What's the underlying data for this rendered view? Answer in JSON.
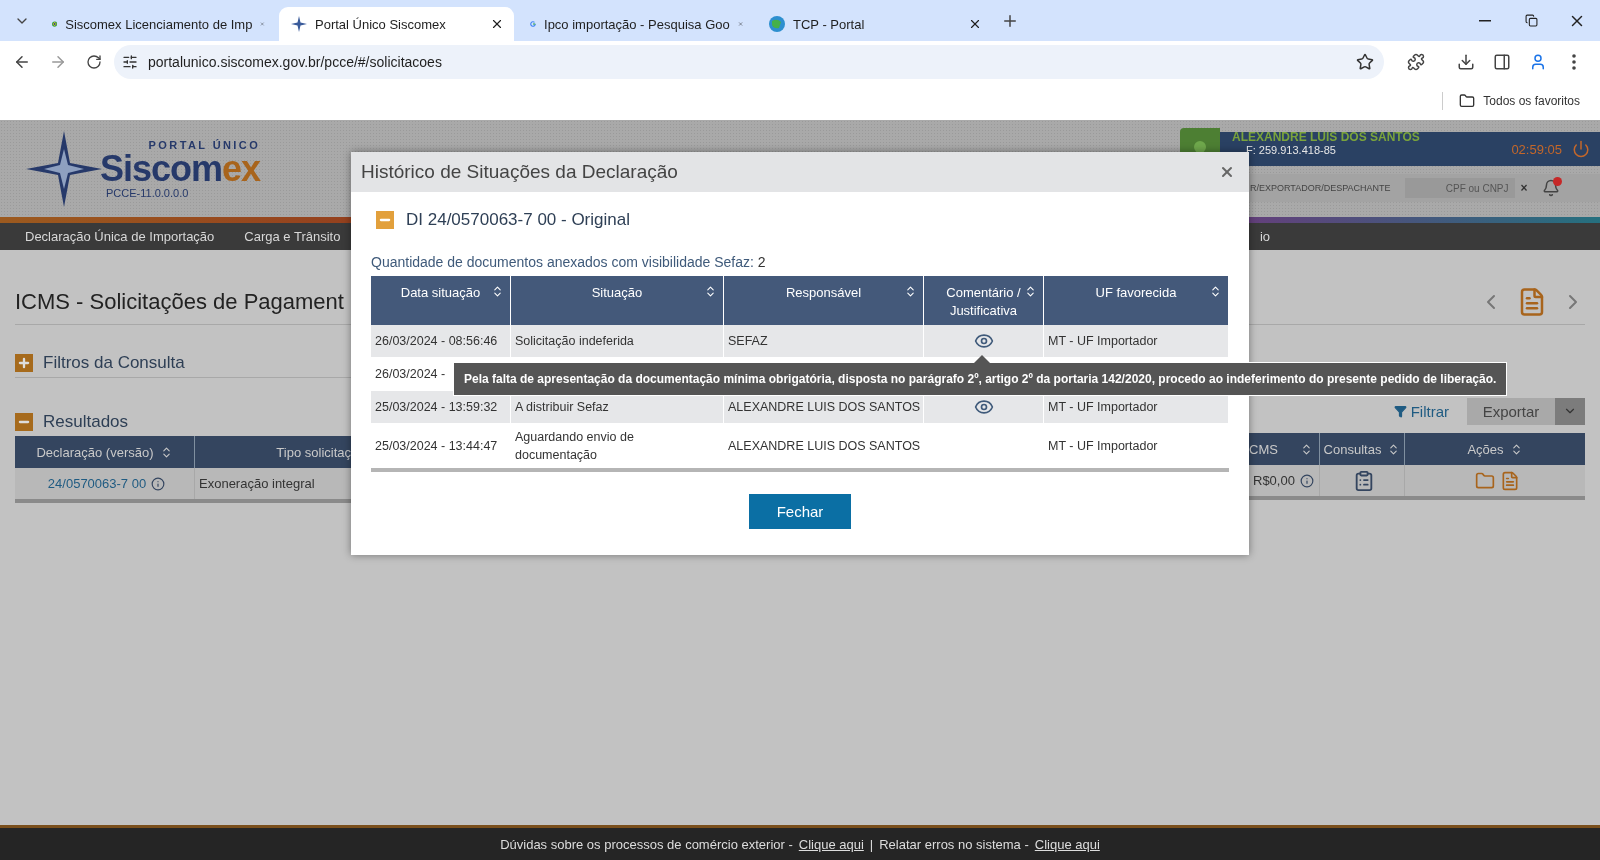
{
  "browser": {
    "tabs": [
      {
        "title": "Siscomex Licenciamento de Imp",
        "selected": false
      },
      {
        "title": "Portal Único Siscomex",
        "selected": true
      },
      {
        "title": "Ipco importação - Pesquisa Goo",
        "selected": false
      },
      {
        "title": "TCP - Portal",
        "selected": false
      }
    ],
    "url": "portalunico.siscomex.gov.br/pcce/#/solicitacoes",
    "bookmarks": "Todos os favoritos"
  },
  "header": {
    "logo": {
      "top": "PORTAL ÚNICO",
      "main": "Siscom",
      "accent": "ex",
      "version": "PCCE-11.0.0.0.0"
    },
    "user": {
      "name": "ALEXANDRE LUIS DOS SANTOS",
      "document": "F: 259.913.418-85",
      "timer": "02:59:05",
      "profile": "R/EXPORTADOR/DESPACHANTE",
      "search_placeholder": "CPF ou CNPJ",
      "clear": "×",
      "has_notification": true
    }
  },
  "nav": [
    "Declaração Única de Importação",
    "Carga e Trânsito",
    "io"
  ],
  "page": {
    "title": "ICMS - Solicitações de Pagament",
    "sections": [
      {
        "label": "Filtros da Consulta",
        "expanded": false
      },
      {
        "label": "Resultados",
        "expanded": true
      }
    ],
    "filter_link": "Filtrar",
    "export_button": "Exportar",
    "table": {
      "columns_left": [
        "Declaração (versão)",
        "Tipo solicitaç"
      ],
      "columns_right": [
        "CMS",
        "Consultas",
        "Ações"
      ],
      "row": {
        "declaration": "24/0570063-7 00",
        "type": "Exoneração integral",
        "value": "R$0,00"
      }
    }
  },
  "modal": {
    "title": "Histórico de Situações da Declaração",
    "section": {
      "label": "DI 24/0570063-7 00 - Original",
      "expanded": true
    },
    "attachments_label": "Quantidade de documentos anexados com visibilidade Sefaz:",
    "attachments_count": "2",
    "columns": [
      "Data situação",
      "Situação",
      "Responsável",
      "Comentário / Justificativa",
      "UF favorecida"
    ],
    "rows": [
      {
        "date": "26/03/2024 - 08:56:46",
        "status": "Solicitação indeferida",
        "owner": "SEFAZ",
        "has_comment": true,
        "uf": "MT - UF Importador"
      },
      {
        "date": "26/03/2024 -"
      },
      {
        "date": "25/03/2024 - 13:59:32",
        "status": "A distribuir Sefaz",
        "owner": "ALEXANDRE LUIS DOS SANTOS",
        "has_comment": true,
        "uf": "MT - UF Importador"
      },
      {
        "date": "25/03/2024 - 13:44:47",
        "status": "Aguardando envio de documentação",
        "owner": "ALEXANDRE LUIS DOS SANTOS",
        "has_comment": false,
        "uf": "MT - UF Importador"
      }
    ],
    "tooltip": "Pela falta de apresentação da documentação mínima obrigatória, disposta no parágrafo 2º, artigo 2º da portaria 142/2020, procedo ao indeferimento do presente pedido de liberação.",
    "close_button": "Fechar"
  },
  "footer": {
    "separator": "|",
    "items": [
      {
        "text": "Dúvidas sobre os processos de comércio exterior -",
        "link": "Clique aqui"
      },
      {
        "text": "Relatar erros no sistema -",
        "link": "Clique aqui"
      }
    ]
  }
}
